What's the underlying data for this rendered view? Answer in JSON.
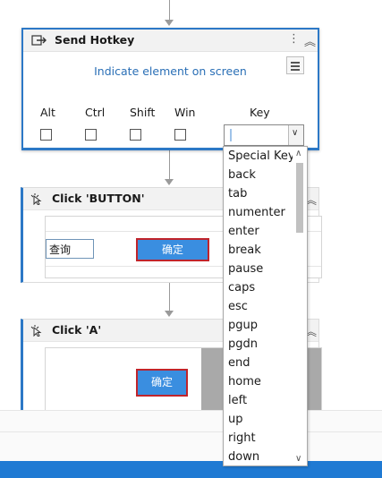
{
  "hotkey_activity": {
    "title": "Send Hotkey",
    "indicate_text": "Indicate element on screen",
    "modifiers": [
      {
        "label": "Alt",
        "checked": false
      },
      {
        "label": "Ctrl",
        "checked": false
      },
      {
        "label": "Shift",
        "checked": false
      },
      {
        "label": "Win",
        "checked": false
      }
    ],
    "key_label": "Key",
    "key_value": ""
  },
  "click_button_activity": {
    "title": "Click 'BUTTON'",
    "preview": {
      "input_text": "查询",
      "button_text": "确定"
    }
  },
  "click_a_activity": {
    "title": "Click 'A'",
    "preview": {
      "button_text": "确定"
    }
  },
  "key_dropdown": {
    "options": [
      "Special Key",
      "back",
      "tab",
      "numenter",
      "enter",
      "break",
      "pause",
      "caps",
      "esc",
      "pgup",
      "pgdn",
      "end",
      "home",
      "left",
      "up",
      "right",
      "down"
    ]
  },
  "colors": {
    "accent": "#2c78c6",
    "link": "#2a6fb6",
    "highlight_outline": "#c0242b",
    "preview_button": "#3a8ee0",
    "status_bar": "#1f7ad3"
  }
}
